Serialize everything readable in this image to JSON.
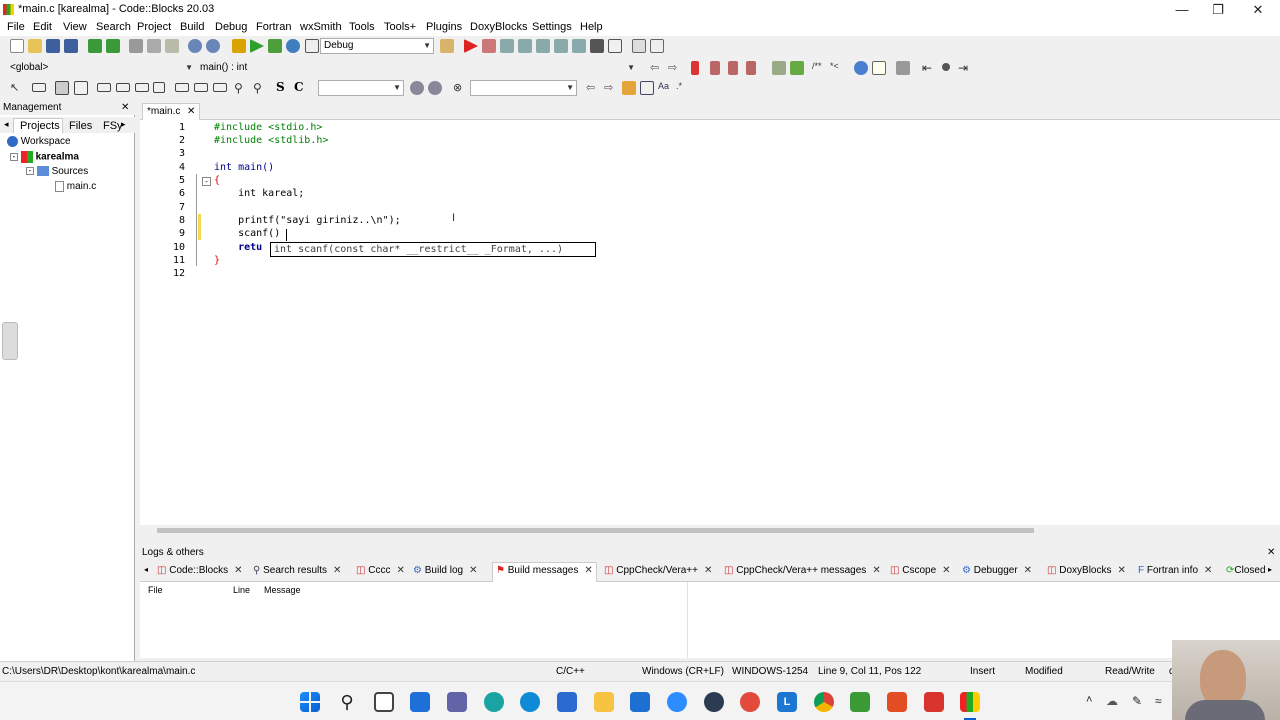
{
  "window": {
    "title": "*main.c [karealma] - Code::Blocks 20.03"
  },
  "menu": [
    "File",
    "Edit",
    "View",
    "Search",
    "Project",
    "Build",
    "Debug",
    "Fortran",
    "wxSmith",
    "Tools",
    "Tools+",
    "Plugins",
    "DoxyBlocks",
    "Settings",
    "Help"
  ],
  "toolbar": {
    "build_target": "Debug",
    "scope": "<global>",
    "function": "main() : int"
  },
  "management": {
    "title": "Management",
    "tabs": [
      "Projects",
      "Files",
      "FSy"
    ],
    "tree": {
      "workspace": "Workspace",
      "project": "karealma",
      "folder": "Sources",
      "file": "main.c"
    }
  },
  "editor": {
    "tab": "*main.c",
    "line_numbers": [
      "1",
      "2",
      "3",
      "4",
      "5",
      "6",
      "7",
      "8",
      "9",
      "10",
      "11",
      "12"
    ],
    "lines": [
      "#include <stdio.h>",
      "#include <stdlib.h>",
      "",
      "int main()",
      "{",
      "    int kareal;",
      "",
      "    printf(\"sayi giriniz..\\n\");",
      "    scanf()",
      "    retu",
      "}",
      ""
    ],
    "calltip": "int scanf(const char* __restrict__ _Format, ...)"
  },
  "logs": {
    "title": "Logs & others",
    "tabs": [
      "Code::Blocks",
      "Search results",
      "Cccc",
      "Build log",
      "Build messages",
      "CppCheck/Vera++",
      "CppCheck/Vera++ messages",
      "Cscope",
      "Debugger",
      "DoxyBlocks",
      "Fortran info",
      "Closed"
    ],
    "columns": [
      "File",
      "Line",
      "Message"
    ]
  },
  "status": {
    "path": "C:\\Users\\DR\\Desktop\\kont\\karealma\\main.c",
    "language": "C/C++",
    "eol": "Windows (CR+LF)",
    "encoding": "WINDOWS-1254",
    "position": "Line 9, Col 11, Pos 122",
    "mode": "Insert",
    "modified": "Modified",
    "access": "Read/Write",
    "profile": "default"
  }
}
